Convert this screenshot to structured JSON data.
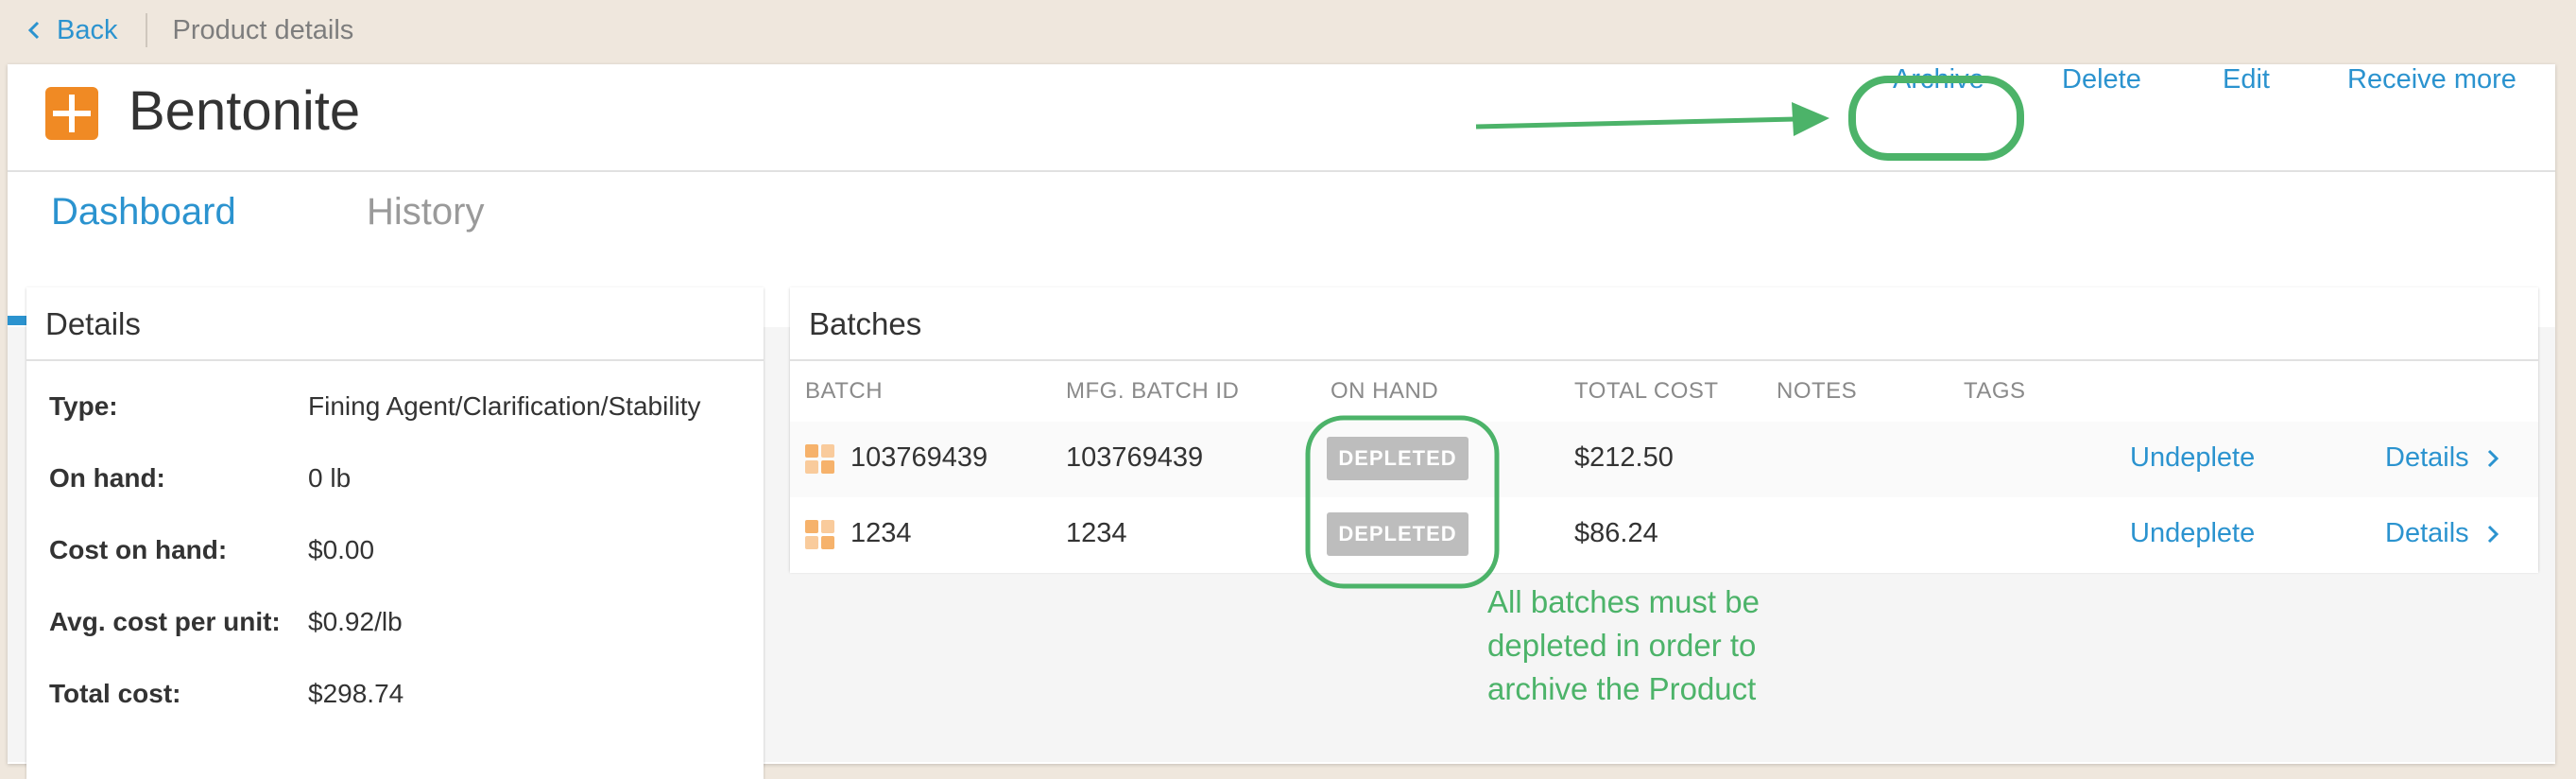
{
  "topbar": {
    "back_label": "Back",
    "breadcrumb": "Product details"
  },
  "product": {
    "name": "Bentonite",
    "icon": "plus-square-icon",
    "icon_color": "#f08a24"
  },
  "actions": {
    "archive": "Archive",
    "delete": "Delete",
    "edit": "Edit",
    "receive_more": "Receive more"
  },
  "tabs": [
    {
      "label": "Dashboard",
      "active": true
    },
    {
      "label": "History",
      "active": false
    }
  ],
  "details": {
    "title": "Details",
    "rows": [
      {
        "label": "Type:",
        "value": "Fining Agent/Clarification/Stability"
      },
      {
        "label": "On hand:",
        "value": "0 lb"
      },
      {
        "label": "Cost on hand:",
        "value": "$0.00"
      },
      {
        "label": "Avg. cost per unit:",
        "value": "$0.92/lb"
      },
      {
        "label": "Total cost:",
        "value": "$298.74"
      }
    ]
  },
  "batches": {
    "title": "Batches",
    "columns": [
      "BATCH",
      "MFG. BATCH ID",
      "ON HAND",
      "TOTAL COST",
      "NOTES",
      "TAGS"
    ],
    "rows": [
      {
        "batch": "103769439",
        "mfg_batch_id": "103769439",
        "on_hand": "DEPLETED",
        "total_cost": "$212.50",
        "notes": "",
        "tags": "",
        "undeplete": "Undeplete",
        "details": "Details"
      },
      {
        "batch": "1234",
        "mfg_batch_id": "1234",
        "on_hand": "DEPLETED",
        "total_cost": "$86.24",
        "notes": "",
        "tags": "",
        "undeplete": "Undeplete",
        "details": "Details"
      }
    ]
  },
  "annotation": {
    "line1": "All batches must be",
    "line2": "depleted in order to",
    "line3": "archive the Product",
    "color": "#4cb369"
  },
  "colors": {
    "link": "#2b93cf",
    "page_bg": "#efe7dd",
    "badge_bg": "#bdbdbd"
  }
}
